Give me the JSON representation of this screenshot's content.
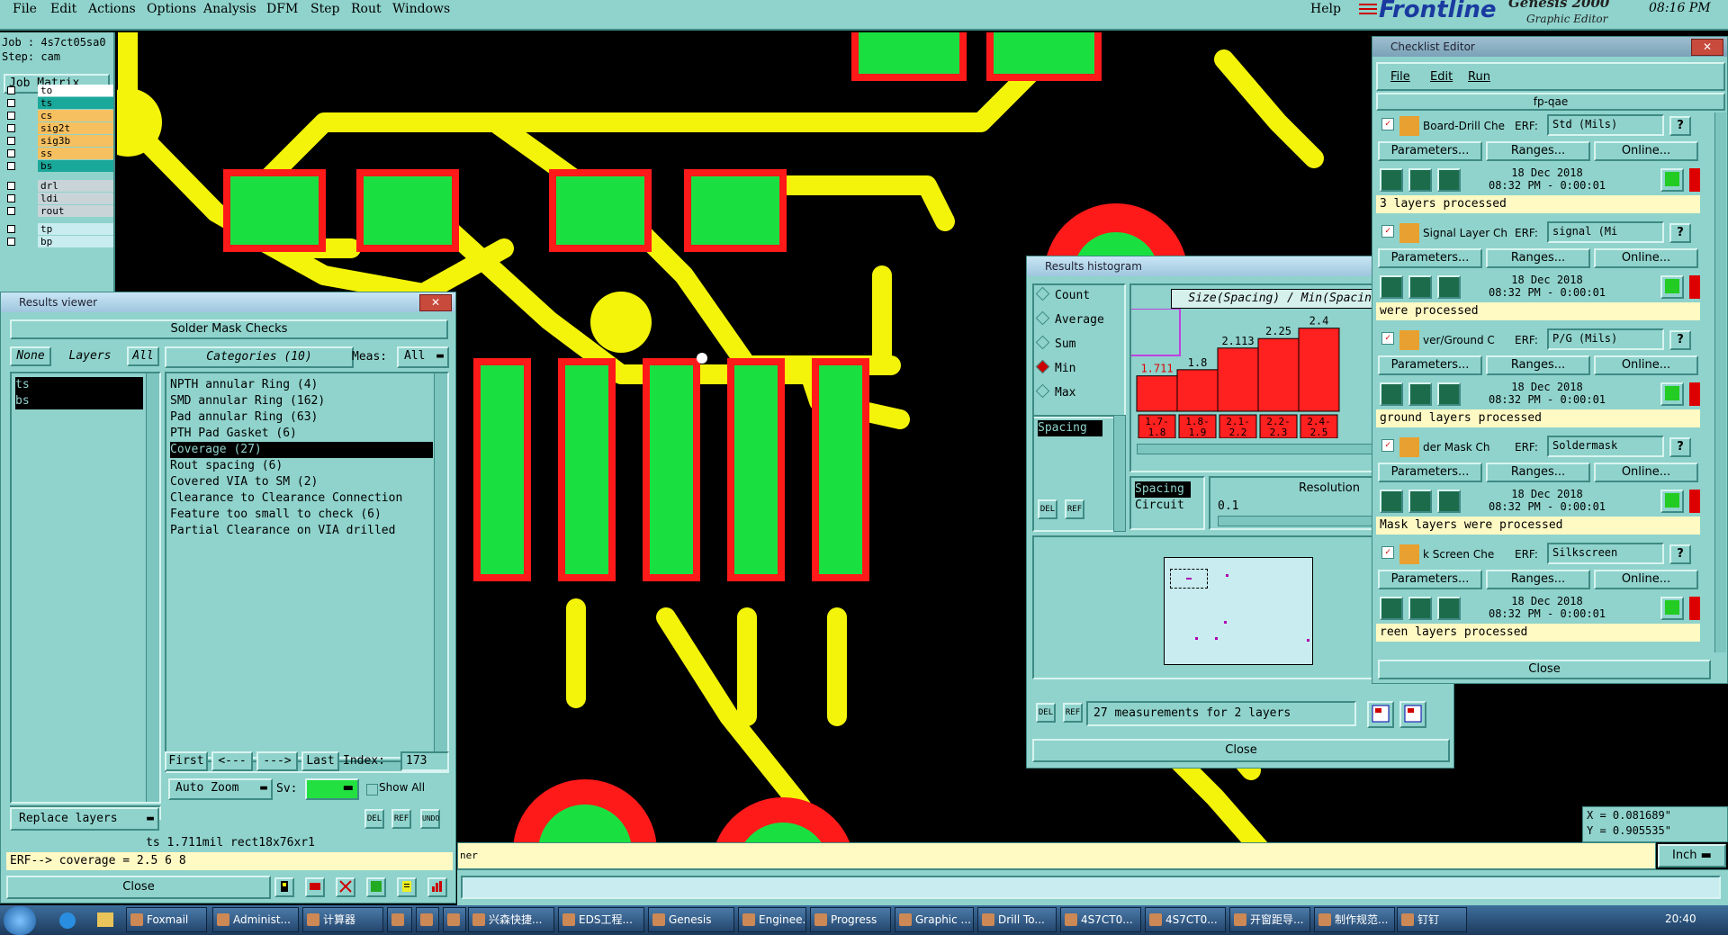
{
  "menubar": {
    "items": [
      {
        "label": "File"
      },
      {
        "label": "Edit"
      },
      {
        "label": "Actions"
      },
      {
        "label": "Options"
      },
      {
        "label": "Analysis"
      },
      {
        "label": "DFM"
      },
      {
        "label": "Step"
      },
      {
        "label": "Rout"
      },
      {
        "label": "Windows"
      }
    ],
    "help": "Help",
    "brand": "Frontline",
    "product": "Genesis 2000",
    "product_sub": "Graphic Editor",
    "clock": "08:16 PM"
  },
  "left_panel": {
    "job": "Job : 4s7ct05sa0",
    "step": "Step: cam",
    "job_matrix": "Job Matrix ...",
    "layers": [
      {
        "name": "to",
        "color": "#ffffff"
      },
      {
        "name": "ts",
        "color": "#1aa89a"
      },
      {
        "name": "cs",
        "color": "#f6c060"
      },
      {
        "name": "sig2t",
        "color": "#f6c060"
      },
      {
        "name": "sig3b",
        "color": "#f6c060"
      },
      {
        "name": "ss",
        "color": "#f6c060"
      },
      {
        "name": "bs",
        "color": "#1aa89a"
      },
      {
        "name": "drl",
        "color": "#c8d4d8"
      },
      {
        "name": "ldi",
        "color": "#c8d4d8"
      },
      {
        "name": "rout",
        "color": "#c8d4d8"
      },
      {
        "name": "tp",
        "color": "#c8ecf0"
      },
      {
        "name": "bp",
        "color": "#c8ecf0"
      }
    ]
  },
  "results_viewer": {
    "title": "Results viewer",
    "header": "Solder Mask Checks",
    "none_btn": "None",
    "layers_label": "Layers",
    "all_btn": "All",
    "layers": [
      "ts",
      "bs"
    ],
    "categories_label": "Categories (10)",
    "meas_label": "Meas:",
    "meas_value": "All",
    "categories": [
      "NPTH annular Ring (4)",
      "SMD annular Ring (162)",
      "Pad annular Ring (63)",
      "PTH Pad Gasket (6)",
      "Coverage (27)",
      "Rout spacing (6)",
      "Covered VIA to SM (2)",
      "Clearance to Clearance Connection",
      "Feature too small to check (6)",
      "Partial Clearance on VIA drilled"
    ],
    "selected_category": 4,
    "first_btn": "First",
    "prev_btn": "<---",
    "next_btn": "--->",
    "last_btn": "Last",
    "index_label": "Index:",
    "index_value": "173",
    "autozoom": "Auto Zoom",
    "sv_label": "Sv:",
    "show_all": "Show All",
    "replace_layers": "Replace layers",
    "del": "DEL",
    "ref": "REF",
    "undo": "UNDO",
    "status_line": "ts 1.711mil   rect18x76xr1",
    "erf_line": "ERF--> coverage = 2.5 6 8",
    "close": "Close"
  },
  "histogram": {
    "title": "Results histogram",
    "modes": [
      {
        "label": "Count",
        "selected": false
      },
      {
        "label": "Average",
        "selected": false
      },
      {
        "label": "Sum",
        "selected": false
      },
      {
        "label": "Min",
        "selected": true
      },
      {
        "label": "Max",
        "selected": false
      }
    ],
    "list_items": [
      "Spacing"
    ],
    "chart_title": "Size(Spacing) / Min(Spacing)",
    "del": "DEL",
    "ref": "REF",
    "field_list": [
      "Spacing",
      "Circuit"
    ],
    "resolution_label": "Resolution",
    "resolution_value": "0.1",
    "summary": "27 measurements for 2 layers",
    "close": "Close"
  },
  "chart_data": {
    "type": "bar",
    "title": "Size(Spacing) / Min(Spacing)",
    "categories": [
      "1.7-1.8",
      "1.8-1.9",
      "2.1-2.2",
      "2.2-2.3",
      "2.4-2.5"
    ],
    "values": [
      1.711,
      1.8,
      2.113,
      2.25,
      2.4
    ],
    "value_labels": [
      "1.711",
      "1.8",
      "2.113",
      "2.25",
      "2.4"
    ],
    "bar_color": "#ff2020",
    "highlight_index": 0,
    "ylim": [
      1.2,
      2.5
    ]
  },
  "checklist": {
    "title": "Checklist Editor",
    "menu": [
      "File",
      "Edit",
      "Run"
    ],
    "name": "fp-qae",
    "erf_label": "ERF:",
    "params": "Parameters...",
    "ranges": "Ranges...",
    "online": "Online...",
    "items": [
      {
        "name": "Board-Drill Che",
        "erf": "Std (Mils)",
        "date": "18 Dec 2018",
        "time": "08:32 PM - 0:00:01",
        "msg": "3 layers processed"
      },
      {
        "name": "Signal Layer Ch",
        "erf": "signal (Mi",
        "date": "18 Dec 2018",
        "time": "08:32 PM - 0:00:01",
        "msg": "were processed"
      },
      {
        "name": "ver/Ground C",
        "erf": "P/G (Mils)",
        "date": "18 Dec 2018",
        "time": "08:32 PM - 0:00:01",
        "msg": "ground layers processed"
      },
      {
        "name": "der Mask Ch",
        "erf": "Soldermask",
        "date": "18 Dec 2018",
        "time": "08:32 PM - 0:00:01",
        "msg": "Mask layers were processed"
      },
      {
        "name": "k Screen Che",
        "erf": "Silkscreen",
        "date": "18 Dec 2018",
        "time": "08:32 PM - 0:00:01",
        "msg": "reen layers processed"
      }
    ],
    "close": "Close"
  },
  "coords": {
    "x": "X = 0.081689\"",
    "y": "Y = 0.905535\""
  },
  "units": "Inch",
  "status_frag": "ner",
  "taskbar": {
    "items": [
      "Foxmail",
      "Administ...",
      "计算器",
      "",
      "",
      "",
      "兴森快捷...",
      "EDS工程...",
      "Genesis",
      "Enginee...",
      "Progress",
      "Graphic ...",
      "Drill To...",
      "4S7CT0...",
      "4S7CT0...",
      "开窗距导...",
      "制作规范...",
      "钉钉"
    ],
    "time": "20:40"
  }
}
